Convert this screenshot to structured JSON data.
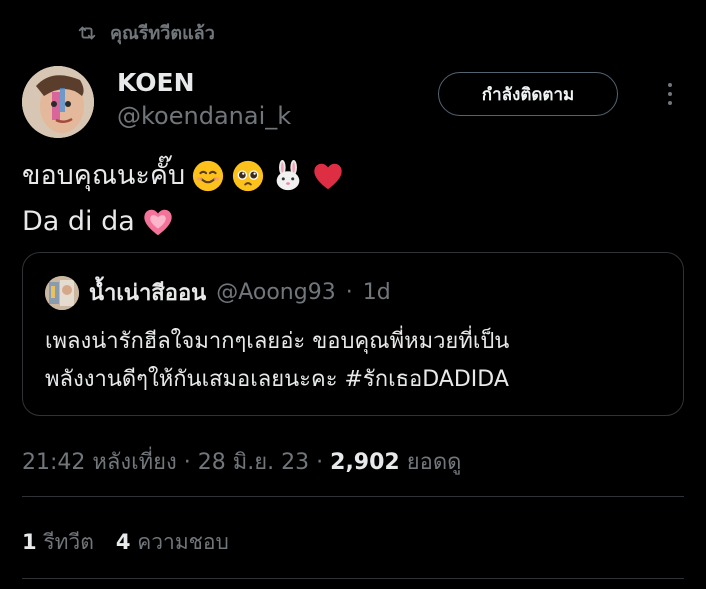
{
  "retweet": {
    "label": "คุณรีทวีตแล้ว",
    "icon": "retweet-icon"
  },
  "author": {
    "name": "KOEN",
    "handle": "@koendanai_k",
    "follow_label": "กำลังติดตาม"
  },
  "tweet": {
    "line1": "ขอบคุณนะคั๊บ",
    "line1_emojis": [
      "smiling-face-emoji",
      "pleading-face-emoji",
      "rabbit-face-emoji",
      "red-heart-emoji"
    ],
    "line2": "Da di da",
    "line2_emojis": [
      "growing-heart-emoji"
    ]
  },
  "quote": {
    "name": "น้ำเน่าสีออน",
    "handle": "@Aoong93",
    "time": "1d",
    "separator": "·",
    "text_line1": "เพลงน่ารักฮีลใจมากๆเลยอ่ะ ขอบคุณพี่หมวยที่เป็น",
    "text_line2": "พลังงานดีๆให้กันเสมอเลยนะคะ #รักเธอDADIDA"
  },
  "meta": {
    "time": "21:42 หลังเที่ยง",
    "date": "28 มิ.ย. 23",
    "separator": "·",
    "views_count": "2,902",
    "views_label": "ยอดดู"
  },
  "stats": {
    "retweets_count": "1",
    "retweets_label": "รีทวีต",
    "likes_count": "4",
    "likes_label": "ความชอบ"
  },
  "colors": {
    "background": "#000000",
    "text_primary": "#e7e9ea",
    "text_secondary": "#71767b",
    "border": "#2f3336"
  }
}
